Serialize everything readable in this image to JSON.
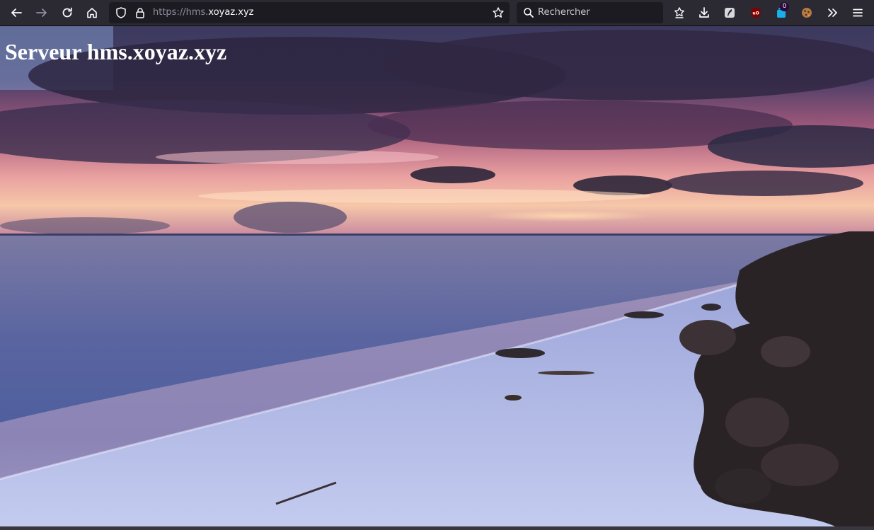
{
  "browser": {
    "url_prefix": "https://hms.",
    "url_domain": "xoyaz.xyz",
    "search_placeholder": "Rechercher",
    "extension_badge_count": "0"
  },
  "page": {
    "title": "Serveur hms.xoyaz.xyz"
  },
  "colors": {
    "toolbar_bg": "#2b2a33",
    "field_bg": "#1c1b22",
    "icon": "#fbfbfe",
    "title_text": "#ffffff"
  },
  "icons": [
    "back-arrow-icon",
    "forward-arrow-icon",
    "reload-icon",
    "home-icon",
    "tracking-shield-icon",
    "lock-icon",
    "bookmark-star-icon",
    "search-icon",
    "pocket-icon",
    "download-icon",
    "feather-extension-icon",
    "ublock-origin-icon",
    "extension-icon",
    "cookie-icon",
    "overflow-chevrons-icon",
    "hamburger-menu-icon"
  ]
}
